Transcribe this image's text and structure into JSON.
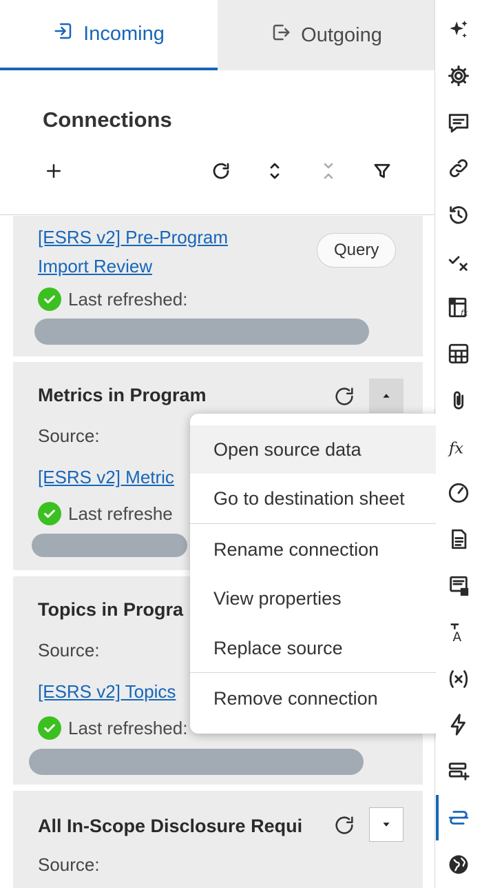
{
  "tabs": {
    "incoming": "Incoming",
    "outgoing": "Outgoing"
  },
  "header": {
    "title": "Connections"
  },
  "cards": [
    {
      "link_line1": "[ESRS v2] Pre-Program",
      "link_line2": "Import Review",
      "badge": "Query",
      "refreshed": "Last refreshed:"
    },
    {
      "name": "Metrics in Program",
      "source_label": "Source:",
      "link": "[ESRS v2] Metric",
      "refreshed": "Last refreshe"
    },
    {
      "name": "Topics in Progra",
      "source_label": "Source:",
      "link": "[ESRS v2] Topics",
      "refreshed": "Last refreshed:"
    },
    {
      "name": "All In-Scope Disclosure Requi",
      "source_label": "Source:"
    }
  ],
  "menu": {
    "items": [
      "Open source data",
      "Go to destination sheet",
      "Rename connection",
      "View properties",
      "Replace source",
      "Remove connection"
    ]
  },
  "colors": {
    "accent": "#1766b8",
    "success": "#3cc021",
    "card_bg": "#ececec",
    "redaction": "#a2abb3"
  },
  "rail_icons": [
    "sparkle-icon",
    "gear-icon",
    "comment-icon",
    "link-icon",
    "history-icon",
    "check-x-icon",
    "formula-sheet-icon",
    "table-icon",
    "attachment-icon",
    "function-icon",
    "gauge-icon",
    "document-icon",
    "form-icon",
    "translate-icon",
    "variable-icon",
    "lightning-icon",
    "add-row-icon",
    "connections-icon",
    "globe-icon"
  ]
}
